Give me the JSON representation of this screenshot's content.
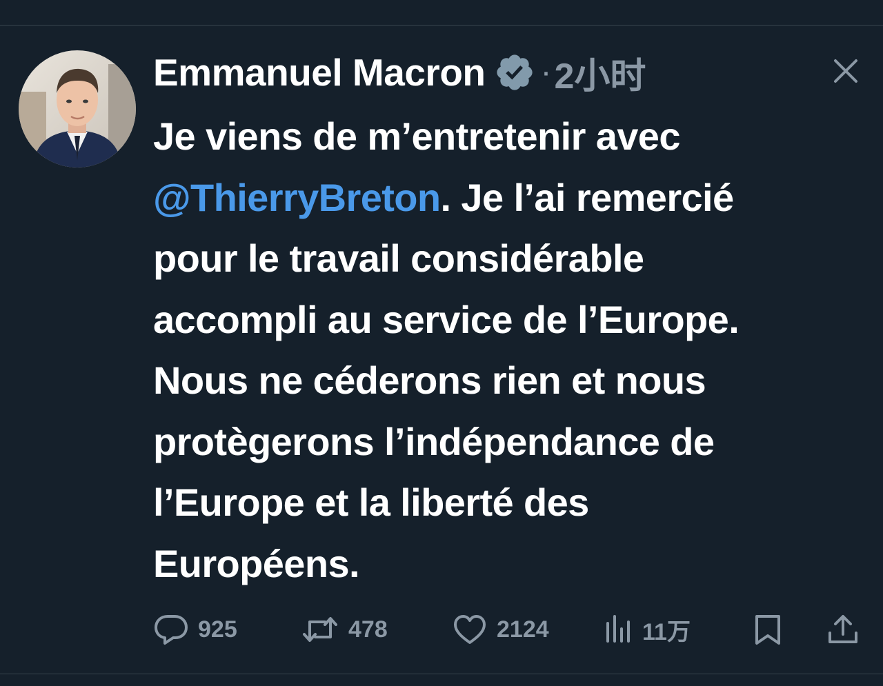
{
  "tweet": {
    "author": {
      "name": "Emmanuel Macron",
      "verified": true
    },
    "time_separator": "·",
    "timestamp": "2小时",
    "text": {
      "line1": "Je viens de m’entretenir avec",
      "mention": "@ThierryBreton",
      "line2_rest": ". Je l’ai remercié",
      "line3": "pour le travail considérable",
      "line4": "accompli au service de l’Europe.",
      "line5": "Nous ne céderons rien et nous",
      "line6": "protègerons l’indépendance de",
      "line7": "l’Europe et la liberté des",
      "line8": "Européens."
    },
    "actions": {
      "replies": "925",
      "retweets": "478",
      "likes": "2124",
      "views": "11万"
    }
  },
  "colors": {
    "background": "#15202b",
    "text": "#ffffff",
    "secondary": "#8b98a5",
    "link": "#4a99e9",
    "divider": "#38444d"
  },
  "icons": {
    "verified": "verified-badge-icon",
    "close": "close-icon",
    "reply": "reply-icon",
    "retweet": "retweet-icon",
    "like": "heart-icon",
    "views": "views-chart-icon",
    "bookmark": "bookmark-icon",
    "share": "share-icon"
  }
}
